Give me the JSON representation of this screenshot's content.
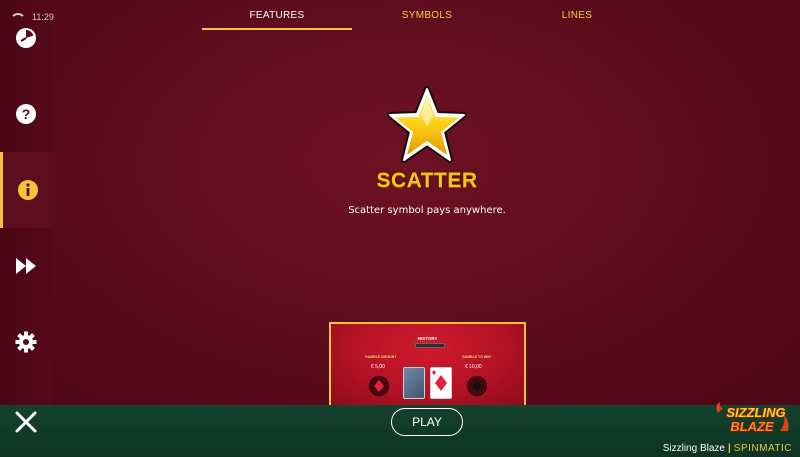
{
  "status": {
    "time": "11:29"
  },
  "tabs": [
    {
      "label": "FEATURES",
      "active": true
    },
    {
      "label": "SYMBOLS",
      "active": false
    },
    {
      "label": "LINES",
      "active": false
    }
  ],
  "sidebar": {
    "items": [
      {
        "icon": "history-clock-icon"
      },
      {
        "icon": "help-icon"
      },
      {
        "icon": "info-icon",
        "active": true
      },
      {
        "icon": "fast-forward-icon"
      },
      {
        "icon": "gear-icon"
      }
    ]
  },
  "feature": {
    "symbol_icon": "gold-star-icon",
    "title": "SCATTER",
    "description": "Scatter symbol pays anywhere."
  },
  "preview": {
    "history_label": "HISTORY",
    "gamble_amount_label": "GAMBLE AMOUNT",
    "gamble_amount_value": "€ 5,00",
    "gamble_to_win_label": "GAMBLE TO WIN",
    "gamble_to_win_value": "€ 10,00"
  },
  "bottom": {
    "play_label": "PLAY",
    "game_name": "Sizzling Blaze",
    "studio": "SPINMATIC",
    "logo_line1": "SIZZLING",
    "logo_line2": "BLAZE"
  },
  "colors": {
    "accent": "#f3c43a",
    "background": "#5c0b1c",
    "bottom_bar": "#0d3323",
    "title": "#f5c518"
  }
}
